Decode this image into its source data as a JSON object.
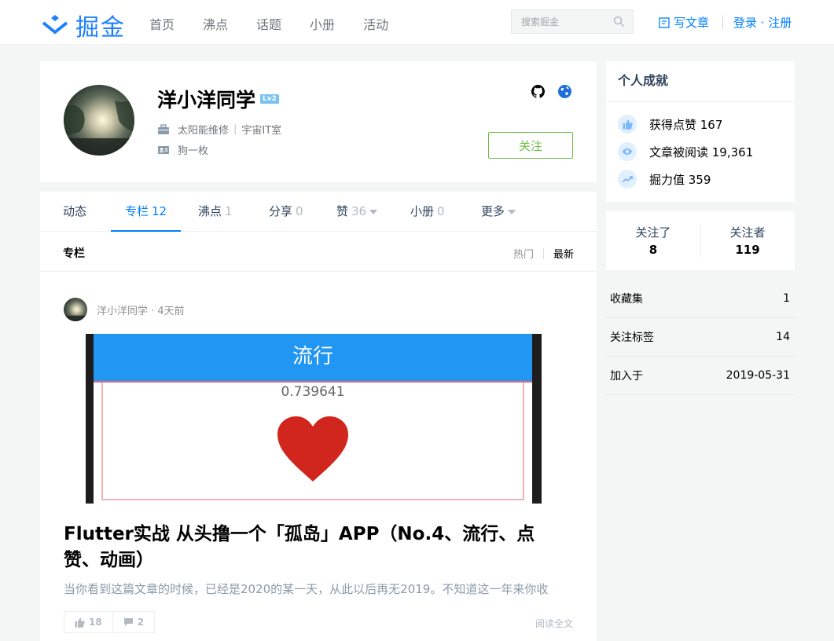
{
  "header": {
    "logo_text": "掘金",
    "nav": [
      "首页",
      "沸点",
      "话题",
      "小册",
      "活动"
    ],
    "search_placeholder": "搜索掘金",
    "write_label": "写文章",
    "auth_label": "登录 · 注册",
    "brand_color": "#1e80ff"
  },
  "profile": {
    "name": "洋小洋同学",
    "level": "Lv2",
    "job": "太阳能维修",
    "company": "宇宙IT室",
    "bio": "狗一枚",
    "follow_label": "关注",
    "social_icons": [
      "github-icon",
      "globe-icon"
    ]
  },
  "tabs": [
    {
      "label": "动态",
      "count": ""
    },
    {
      "label": "专栏",
      "count": "12"
    },
    {
      "label": "沸点",
      "count": "1"
    },
    {
      "label": "分享",
      "count": "0"
    },
    {
      "label": "赞",
      "count": "36"
    },
    {
      "label": "小册",
      "count": "0"
    },
    {
      "label": "更多",
      "count": ""
    }
  ],
  "active_tab": "专栏",
  "section": {
    "title": "专栏",
    "sort_hot": "热门",
    "sort_new": "最新"
  },
  "article": {
    "author": "洋小洋同学",
    "time": "4天前",
    "meta": "洋小洋同学 · 4天前",
    "thumb_bar_text": "流行",
    "thumb_number": "0.739641",
    "title": "Flutter实战 从头撸一个「孤岛」APP（No.4、流行、点赞、动画）",
    "excerpt": "当你看到这篇文章的时候，已经是2020的某一天，从此以后再无2019。不知道这一年来你收",
    "likes": "18",
    "comments": "2",
    "read_more": "阅读全文"
  },
  "sidebar": {
    "achievements_title": "个人成就",
    "achievements": [
      {
        "icon": "thumbs-up-icon",
        "text": "获得点赞 167"
      },
      {
        "icon": "eye-icon",
        "text": "文章被阅读 19,361"
      },
      {
        "icon": "trend-icon",
        "text": "掘力值 359"
      }
    ],
    "following_label": "关注了",
    "following_count": "8",
    "followers_label": "关注者",
    "followers_count": "119",
    "stats": [
      {
        "label": "收藏集",
        "value": "1"
      },
      {
        "label": "关注标签",
        "value": "14"
      },
      {
        "label": "加入于",
        "value": "2019-05-31"
      }
    ]
  }
}
